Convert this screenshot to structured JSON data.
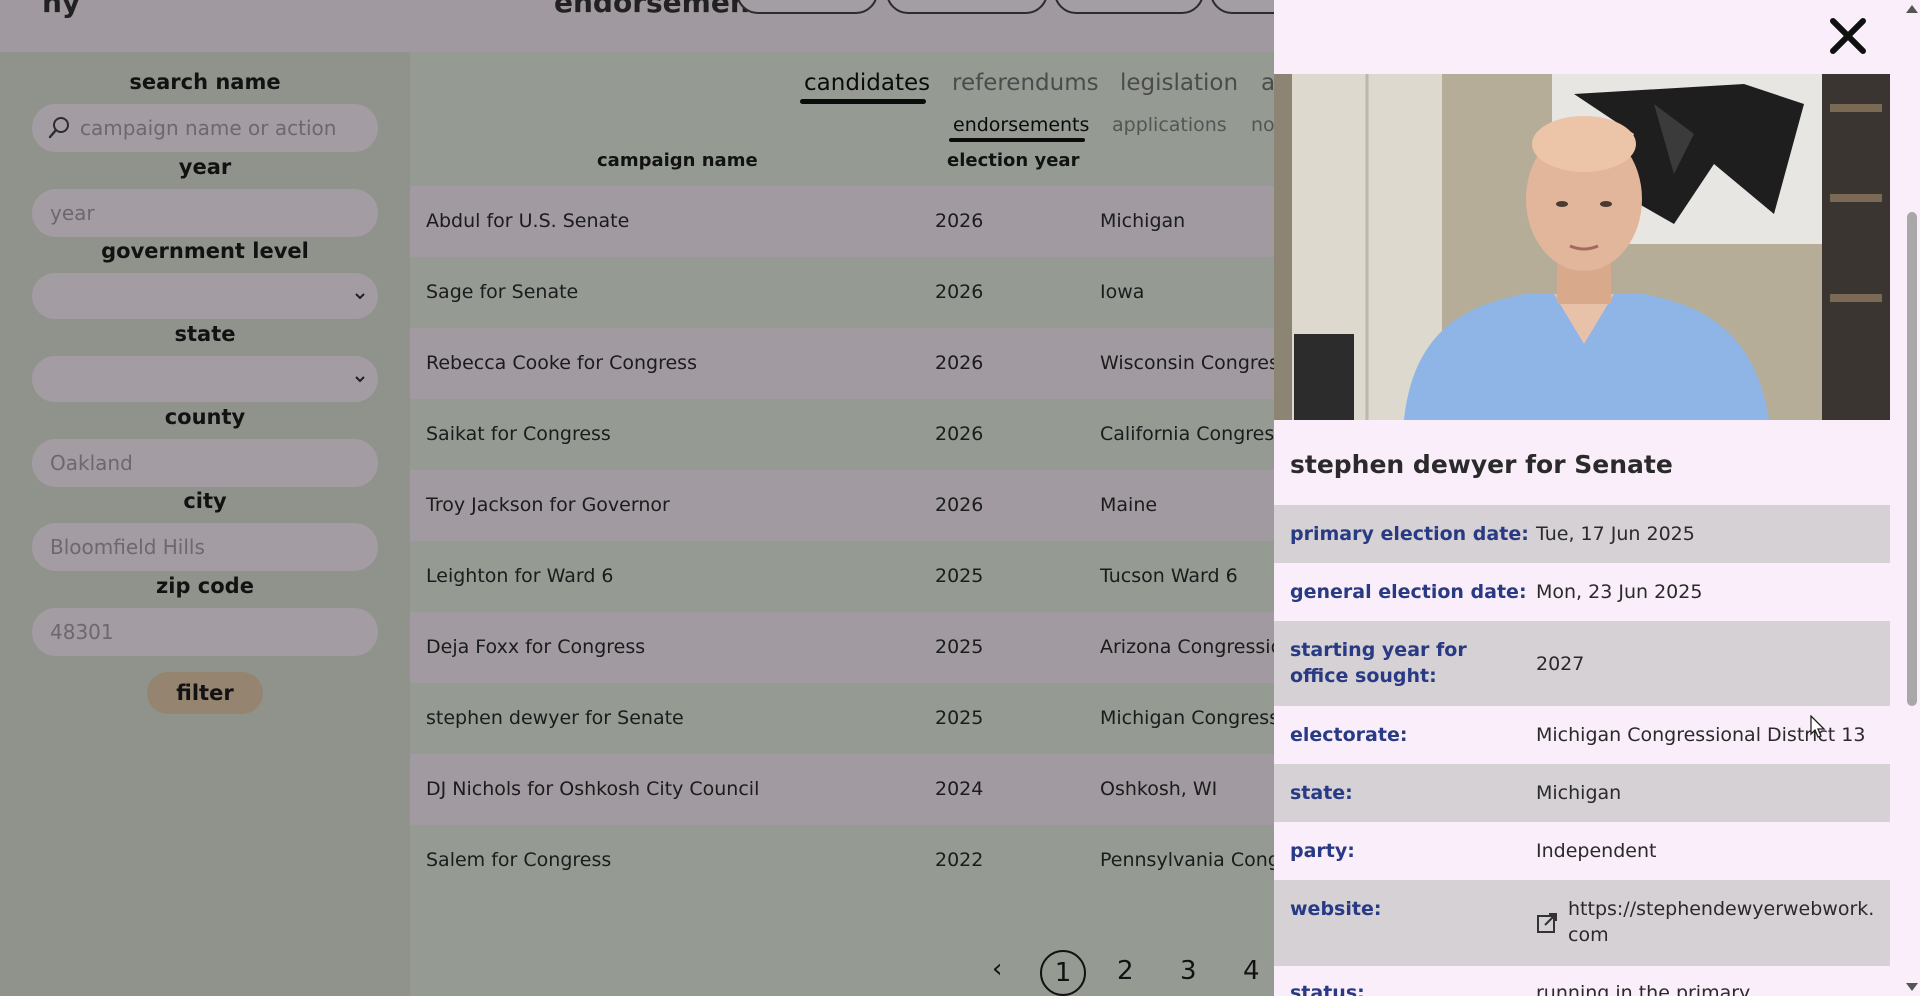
{
  "topbar": {
    "partial_heading": "endorsement",
    "partial_left": "ny"
  },
  "sidebar": {
    "search_name_label": "search name",
    "search_placeholder": "campaign name or action",
    "year_label": "year",
    "year_placeholder": "year",
    "government_level_label": "government level",
    "state_label": "state",
    "county_label": "county",
    "county_value": "Oakland",
    "city_label": "city",
    "city_value": "Bloomfield Hills",
    "zip_label": "zip code",
    "zip_value": "48301",
    "filter_label": "filter"
  },
  "main": {
    "tabs": [
      "candidates",
      "referendums",
      "legislation",
      "a"
    ],
    "active_tab": "candidates",
    "subtabs": [
      "endorsements",
      "applications",
      "no"
    ],
    "active_subtab": "endorsements",
    "columns": [
      "campaign name",
      "election year"
    ],
    "rows": [
      {
        "name": "Abdul for U.S. Senate",
        "year": "2026",
        "area": "Michigan"
      },
      {
        "name": "Sage for Senate",
        "year": "2026",
        "area": "Iowa"
      },
      {
        "name": "Rebecca Cooke for Congress",
        "year": "2026",
        "area": "Wisconsin Congress"
      },
      {
        "name": "Saikat for Congress",
        "year": "2026",
        "area": "California Congressi"
      },
      {
        "name": "Troy Jackson for Governor",
        "year": "2026",
        "area": "Maine"
      },
      {
        "name": "Leighton for Ward 6",
        "year": "2025",
        "area": "Tucson Ward 6"
      },
      {
        "name": "Deja Foxx for Congress",
        "year": "2025",
        "area": "Arizona Congressior"
      },
      {
        "name": "stephen dewyer for Senate",
        "year": "2025",
        "area": "Michigan Congressio"
      },
      {
        "name": "DJ Nichols for Oshkosh City Council",
        "year": "2024",
        "area": "Oshkosh, WI"
      },
      {
        "name": "Salem for Congress",
        "year": "2022",
        "area": "Pennsylvania Congr"
      }
    ],
    "pagination": {
      "prev": "‹",
      "pages": [
        "1",
        "2",
        "3",
        "4"
      ],
      "current": "1"
    }
  },
  "drawer": {
    "close_label": "✕",
    "title": "stephen dewyer for Senate",
    "details": [
      {
        "label": "primary election date:",
        "value": "Tue, 17 Jun 2025"
      },
      {
        "label": "general election date:",
        "value": "Mon, 23 Jun 2025"
      },
      {
        "label": "starting year for office sought:",
        "value": "2027"
      },
      {
        "label": "electorate:",
        "value": "Michigan Congressional District 13"
      },
      {
        "label": "state:",
        "value": "Michigan"
      },
      {
        "label": "party:",
        "value": "Independent"
      },
      {
        "label": "website:",
        "value": "https://stephendewyerwebwork.com"
      },
      {
        "label": "status:",
        "value": "running in the primary"
      }
    ]
  },
  "colors": {
    "sidebar_bg": "#dadfd5",
    "main_bg": "#e3ece0",
    "row_alt_bg": "#f4ebf4",
    "drawer_bg": "#f9eef9",
    "label_blue": "#283a84",
    "filter_button": "#e3c9a9"
  },
  "icons": {
    "search": "search-icon",
    "close": "close-icon",
    "external": "external-link-icon",
    "chevron": "chevron-down-icon"
  }
}
